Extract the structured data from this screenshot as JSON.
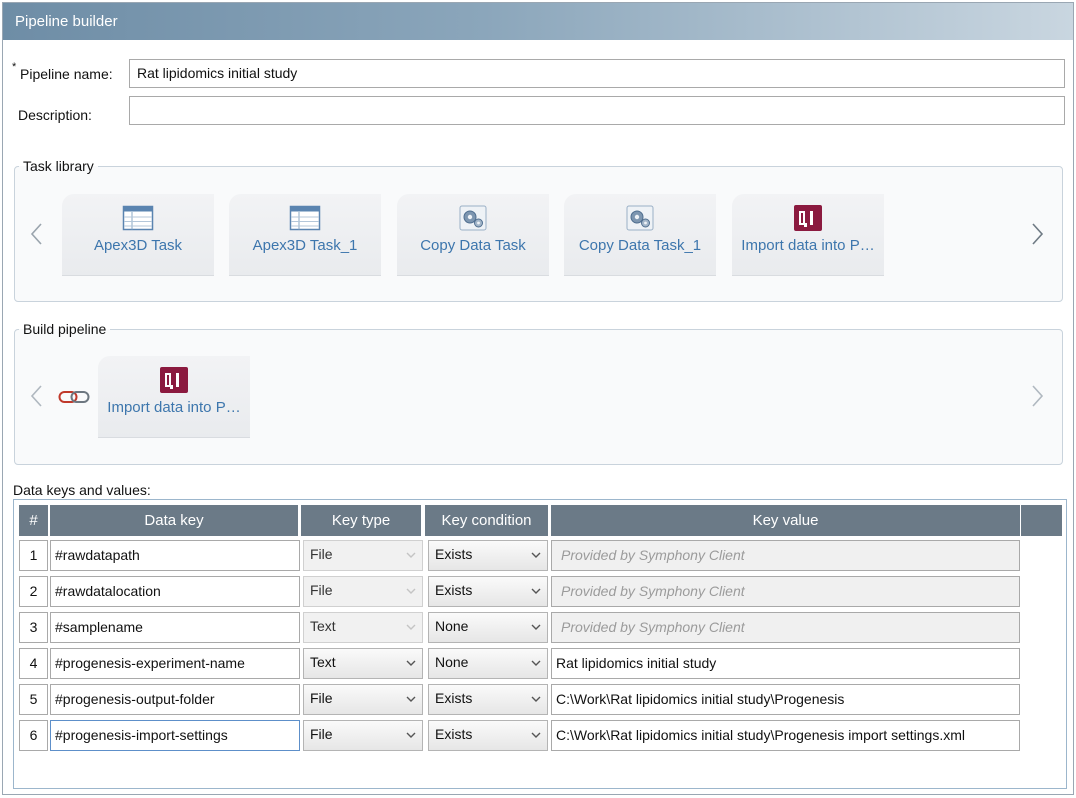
{
  "window": {
    "title": "Pipeline builder"
  },
  "form": {
    "required_mark": "*",
    "name_label": "Pipeline name:",
    "name_value": "Rat lipidomics initial study",
    "description_label": "Description:",
    "description_value": ""
  },
  "task_library": {
    "legend": "Task library",
    "tasks": [
      {
        "label": "Apex3D Task",
        "icon": "table-icon"
      },
      {
        "label": "Apex3D Task_1",
        "icon": "table-icon"
      },
      {
        "label": "Copy Data Task",
        "icon": "gears-icon"
      },
      {
        "label": "Copy Data Task_1",
        "icon": "gears-icon"
      },
      {
        "label": "Import data into P…",
        "icon": "qi-icon"
      }
    ]
  },
  "build_pipeline": {
    "legend": "Build pipeline",
    "chain_icon": "link-icon",
    "tasks": [
      {
        "label": "Import data into P…",
        "icon": "qi-icon"
      }
    ]
  },
  "data_keys": {
    "title": "Data keys and values:",
    "columns": [
      "#",
      "Data key",
      "Key type",
      "Key condition",
      "Key value"
    ],
    "rows": [
      {
        "num": "1",
        "key": "#rawdatapath",
        "type": "File",
        "condition": "Exists",
        "value": "Provided by Symphony Client",
        "value_readonly": true,
        "type_disabled": true
      },
      {
        "num": "2",
        "key": "#rawdatalocation",
        "type": "File",
        "condition": "Exists",
        "value": "Provided by Symphony Client",
        "value_readonly": true,
        "type_disabled": true
      },
      {
        "num": "3",
        "key": "#samplename",
        "type": "Text",
        "condition": "None",
        "value": "Provided by Symphony Client",
        "value_readonly": true,
        "type_disabled": true
      },
      {
        "num": "4",
        "key": "#progenesis-experiment-name",
        "type": "Text",
        "condition": "None",
        "value": "Rat lipidomics initial study",
        "value_readonly": false,
        "type_disabled": false
      },
      {
        "num": "5",
        "key": "#progenesis-output-folder",
        "type": "File",
        "condition": "Exists",
        "value": "C:\\Work\\Rat lipidomics initial study\\Progenesis",
        "value_readonly": false,
        "type_disabled": false
      },
      {
        "num": "6",
        "key": "#progenesis-import-settings",
        "type": "File",
        "condition": "Exists",
        "value": "C:\\Work\\Rat lipidomics initial study\\Progenesis import settings.xml",
        "value_readonly": false,
        "type_disabled": false
      }
    ]
  },
  "colors": {
    "title_gradient_start": "#6e8da6",
    "header_bg": "#6b7a87",
    "link_text": "#3d76ad",
    "qi_icon": "#8b1a3f"
  }
}
